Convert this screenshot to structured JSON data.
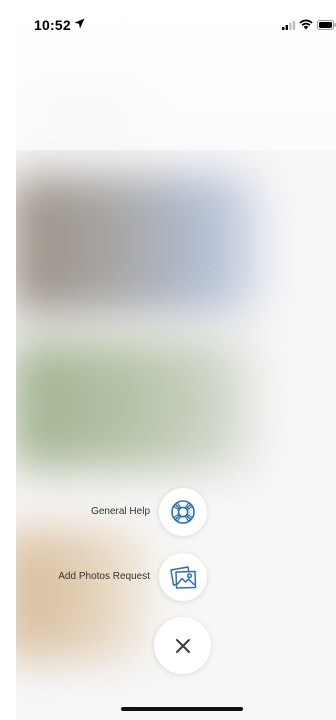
{
  "status_bar": {
    "time": "10:52",
    "icons": [
      "location-arrow-icon",
      "cellular-signal-icon",
      "wifi-icon",
      "battery-icon"
    ]
  },
  "fab_menu": {
    "items": [
      {
        "label": "General Help",
        "icon": "lifebuoy-icon"
      },
      {
        "label": "Add Photos Request",
        "icon": "photos-icon"
      }
    ],
    "close_icon": "close-icon",
    "accent_color": "#2e6fb4"
  }
}
